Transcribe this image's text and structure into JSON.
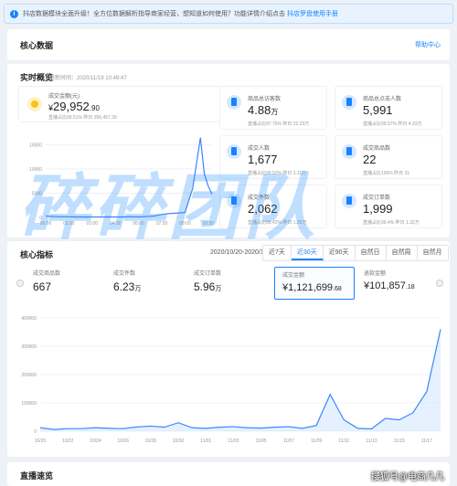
{
  "notice": {
    "text": "抖店数据模块全面升级！全方位数据解析指导商家经营，想知道如何使用？功能详情介绍点击",
    "link": "抖店罗盘使用手册"
  },
  "core": {
    "title": "核心数据",
    "help": "帮助中心"
  },
  "realtime": {
    "title": "实时概览",
    "updated": "更新时间：2020/11/19 10:49:47",
    "main": {
      "label": "成交金额(元)",
      "prefix": "¥",
      "value": "29,952",
      "decimal": ".90",
      "sub": "直播占比99.51%   昨日 356,457.39"
    },
    "metrics": [
      {
        "label": "商品总访客数",
        "value": "4.88",
        "unit": "万",
        "sub": "直播占比97.75%   昨日 22.23万"
      },
      {
        "label": "商品总点击人数",
        "value": "5,991",
        "unit": "",
        "sub": "直播占比99.57%   昨日 4.33万"
      },
      {
        "label": "成交人数",
        "value": "1,677",
        "unit": "",
        "sub": "直播占比99.52%   昨日 1.11万"
      },
      {
        "label": "成交商品数",
        "value": "22",
        "unit": "",
        "sub": "直播占比100%   昨日 31"
      },
      {
        "label": "成交件数",
        "value": "2,062",
        "unit": "",
        "sub": "直播占比99.42%   昨日 1.35万"
      },
      {
        "label": "成交订单数",
        "value": "1,999",
        "unit": "",
        "sub": "直播占比99.4%   昨日 1.32万"
      }
    ]
  },
  "indicators": {
    "title": "核心指标",
    "daterange": "2020/10/20-2020/11/18",
    "tabs": [
      "近7天",
      "近30天",
      "近90天",
      "自然日",
      "自然周",
      "自然月"
    ],
    "active_tab": "近30天",
    "kpis": [
      {
        "label": "成交商品数",
        "value": "667",
        "unit": "",
        "decimal": ""
      },
      {
        "label": "成交件数",
        "value": "6.23",
        "unit": "万",
        "decimal": ""
      },
      {
        "label": "成交订单数",
        "value": "5.96",
        "unit": "万",
        "decimal": ""
      },
      {
        "label": "成交金额",
        "value": "¥1,121,699",
        "unit": "",
        "decimal": ".68"
      },
      {
        "label": "退款金额",
        "value": "¥101,857",
        "unit": "",
        "decimal": ".18"
      }
    ]
  },
  "live": {
    "title": "直播速览"
  },
  "watermark": "碎碎团队",
  "credit": "搜狐号@电商几几",
  "colors": {
    "accent": "#1a82ff",
    "line": "#3b86ff",
    "fill": "#d6e8ff"
  },
  "chart_data": [
    {
      "type": "line",
      "x_ticks": [
        "00:00",
        "01:30",
        "03:00",
        "04:30",
        "06:00",
        "07:30",
        "09:00",
        "10:30"
      ],
      "y_ticks": [
        0,
        5000,
        10000,
        15000
      ],
      "ylim": [
        0,
        17000
      ],
      "x": [
        0,
        0.5,
        1,
        1.5,
        2,
        2.5,
        3,
        3.5,
        4,
        4.5,
        5,
        5.5,
        6,
        6.5,
        7,
        7.5,
        8,
        8.5,
        9,
        9.5,
        10,
        10.25,
        10.5,
        10.75
      ],
      "values": [
        300,
        200,
        150,
        150,
        100,
        100,
        100,
        100,
        120,
        100,
        100,
        150,
        100,
        200,
        300,
        600,
        800,
        900,
        1000,
        6000,
        16500,
        9000,
        6500,
        4800
      ]
    },
    {
      "type": "area",
      "categories": [
        "10/20",
        "10/21",
        "10/22",
        "10/23",
        "10/24",
        "10/25",
        "10/26",
        "10/27",
        "10/28",
        "10/29",
        "10/30",
        "10/31",
        "11/01",
        "11/02",
        "11/03",
        "11/04",
        "11/05",
        "11/06",
        "11/07",
        "11/08",
        "11/09",
        "11/10",
        "11/11",
        "11/12",
        "11/13",
        "11/14",
        "11/15",
        "11/16",
        "11/17",
        "11/18"
      ],
      "x_ticks": [
        "10/20",
        "10/22",
        "10/24",
        "10/26",
        "10/28",
        "10/30",
        "11/01",
        "11/03",
        "11/05",
        "11/07",
        "11/09",
        "11/11",
        "11/13",
        "11/15",
        "11/17"
      ],
      "y_ticks": [
        0,
        100000,
        200000,
        300000,
        400000
      ],
      "ylim": [
        0,
        400000
      ],
      "values": [
        12000,
        6000,
        9000,
        9000,
        12000,
        10000,
        9000,
        15000,
        18000,
        14000,
        30000,
        12000,
        10000,
        14000,
        16000,
        12000,
        11000,
        14000,
        16000,
        10000,
        20000,
        130000,
        40000,
        10000,
        8000,
        45000,
        40000,
        65000,
        140000,
        360000
      ]
    }
  ]
}
